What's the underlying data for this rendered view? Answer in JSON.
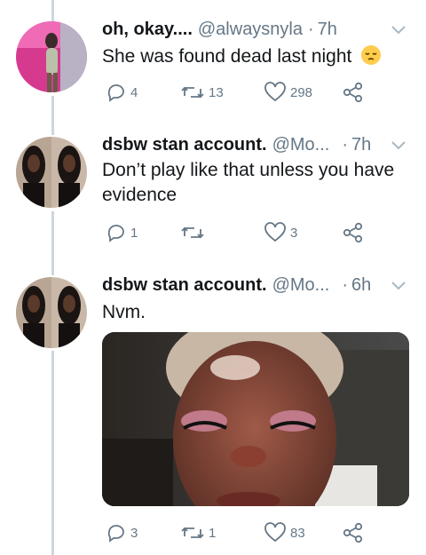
{
  "tweets": [
    {
      "name": "oh, okay....",
      "handle": "@alwaysnyla",
      "sep": "·",
      "time": "7h",
      "text": "She was found dead last night",
      "emoji": "pensive-face",
      "replies": "4",
      "retweets": "13",
      "likes": "298"
    },
    {
      "name": "dsbw stan account.",
      "handle": "@Mo...",
      "sep": "·",
      "time": "7h",
      "text_line1": "Don’t play like that unless you have",
      "text_line2": "evidence",
      "replies": "1",
      "retweets": "",
      "likes": "3"
    },
    {
      "name": "dsbw stan account.",
      "handle": "@Mo...",
      "sep": "·",
      "time": "6h",
      "text": "Nvm.",
      "replies": "3",
      "retweets": "1",
      "likes": "83",
      "media": "selfie-photo"
    }
  ],
  "colors": {
    "text": "#14171a",
    "muted": "#657786",
    "thread_line": "#ccd6dd"
  }
}
